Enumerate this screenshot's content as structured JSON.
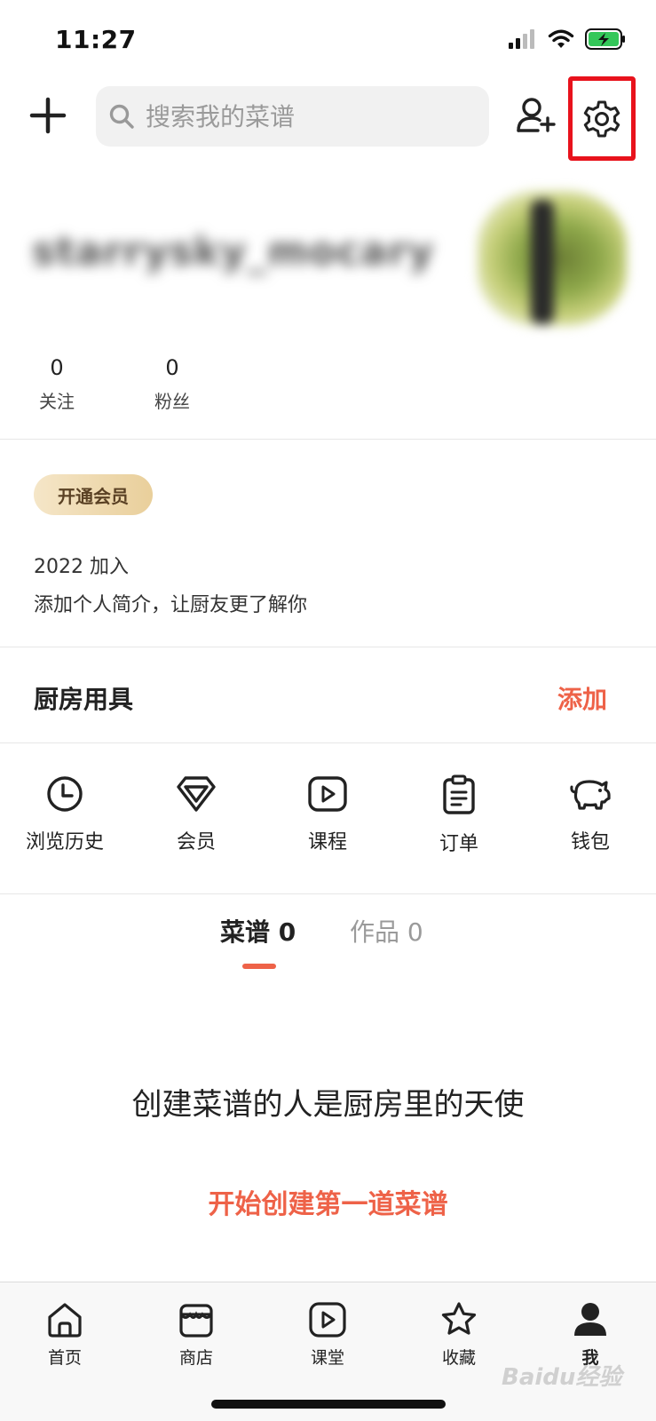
{
  "status_bar": {
    "time": "11:27"
  },
  "search": {
    "placeholder": "搜索我的菜谱"
  },
  "profile": {
    "username": "starrysky_mocary",
    "stats": [
      {
        "value": "0",
        "label": "关注"
      },
      {
        "value": "0",
        "label": "粉丝"
      }
    ],
    "vip_label": "开通会员",
    "joined": "2022 加入",
    "bio": "添加个人简介，让厨友更了解你"
  },
  "kitchen": {
    "title": "厨房用具",
    "add_label": "添加"
  },
  "shortcuts": [
    {
      "label": "浏览历史",
      "icon": "clock-icon"
    },
    {
      "label": "会员",
      "icon": "diamond-icon"
    },
    {
      "label": "课程",
      "icon": "play-icon"
    },
    {
      "label": "订单",
      "icon": "clipboard-icon"
    },
    {
      "label": "钱包",
      "icon": "piggy-bank-icon"
    }
  ],
  "tabs": [
    {
      "label": "菜谱 0",
      "active": true
    },
    {
      "label": "作品 0",
      "active": false
    }
  ],
  "empty_state": {
    "message": "创建菜谱的人是厨房里的天使",
    "action": "开始创建第一道菜谱"
  },
  "bottom_nav": [
    {
      "label": "首页",
      "icon": "home-icon"
    },
    {
      "label": "商店",
      "icon": "store-icon"
    },
    {
      "label": "课堂",
      "icon": "play-icon"
    },
    {
      "label": "收藏",
      "icon": "star-icon"
    },
    {
      "label": "我",
      "icon": "user-icon"
    }
  ],
  "colors": {
    "accent": "#ee6248",
    "highlight_box": "#e8121c",
    "vip_gold": "#e9cf9b",
    "battery": "#34c759"
  },
  "watermark": "Baidu经验"
}
